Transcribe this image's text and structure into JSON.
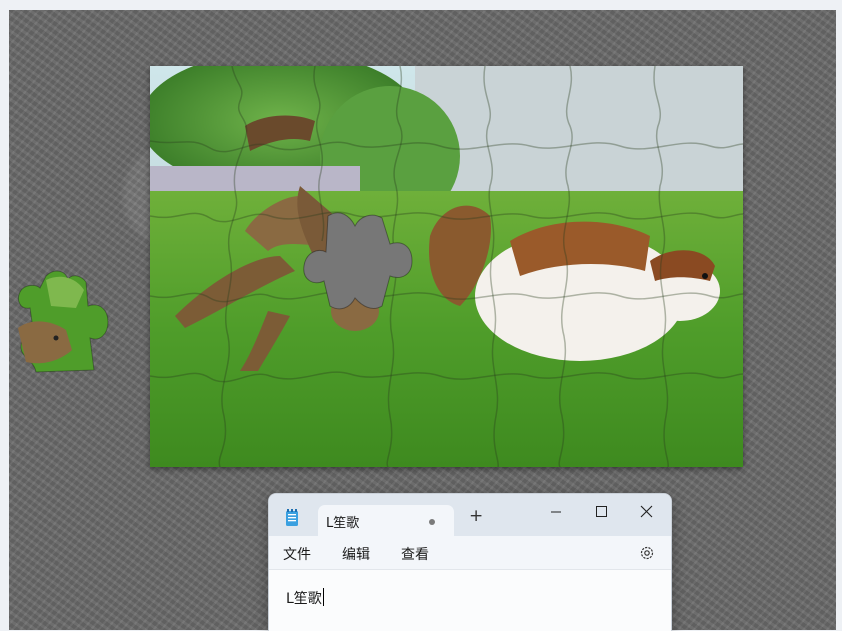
{
  "puzzle": {
    "icon": "jigsaw-puzzle-image"
  },
  "notepad": {
    "tab_title": "L笙歌",
    "new_tab_label": "+",
    "menu": {
      "file": "文件",
      "edit": "编辑",
      "view": "查看"
    },
    "content": "L笙歌"
  },
  "colors": {
    "board": "#6b6b6b",
    "grass": "#4a9a2a",
    "titlebar": "#dfe6ee"
  }
}
